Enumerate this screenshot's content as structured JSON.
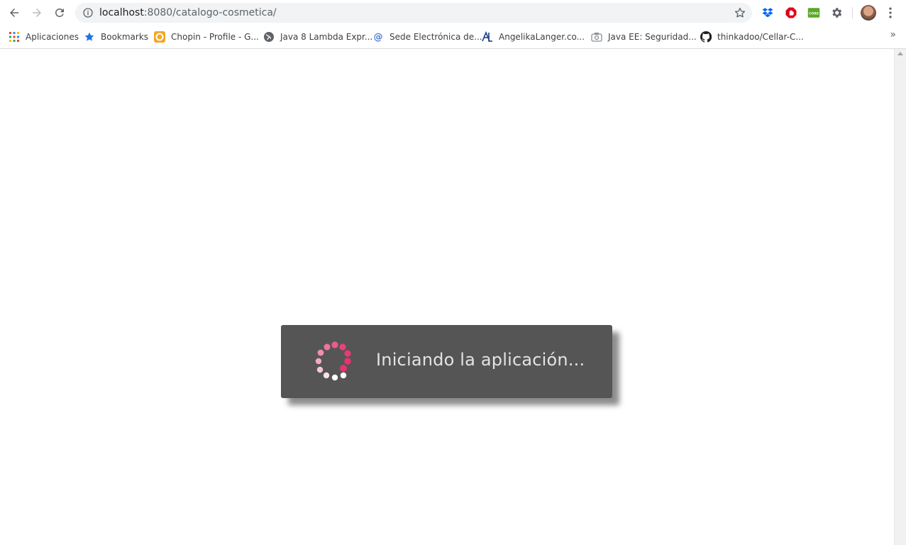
{
  "browser": {
    "url_host": "localhost",
    "url_rest": ":8080/catalogo-cosmetica/"
  },
  "bookmarks": [
    {
      "label": "Aplicaciones",
      "icon": "apps-grid-icon"
    },
    {
      "label": "Bookmarks",
      "icon": "star-icon"
    },
    {
      "label": "Chopin - Profile - G...",
      "icon": "goodreads-icon"
    },
    {
      "label": "Java 8 Lambda Expr...",
      "icon": "globe-icon"
    },
    {
      "label": "Sede Electrónica de...",
      "icon": "at-icon"
    },
    {
      "label": "AngelikaLanger.co...",
      "icon": "al-logo-icon"
    },
    {
      "label": "Java EE: Seguridad...",
      "icon": "camera-icon"
    },
    {
      "label": "thinkadoo/Cellar-C...",
      "icon": "github-icon"
    }
  ],
  "extensions": [
    {
      "name": "dropbox-icon",
      "color": "#0061fe"
    },
    {
      "name": "adblock-icon",
      "color": "#e0001b"
    },
    {
      "name": "cors-icon",
      "label": "CORS",
      "color": "#5ba829"
    },
    {
      "name": "gear-extension-icon",
      "color": "#5f6368"
    }
  ],
  "overflow_label": "»",
  "loader": {
    "message": "Iniciando la aplicación...",
    "spinner_color": "#e8336f"
  }
}
